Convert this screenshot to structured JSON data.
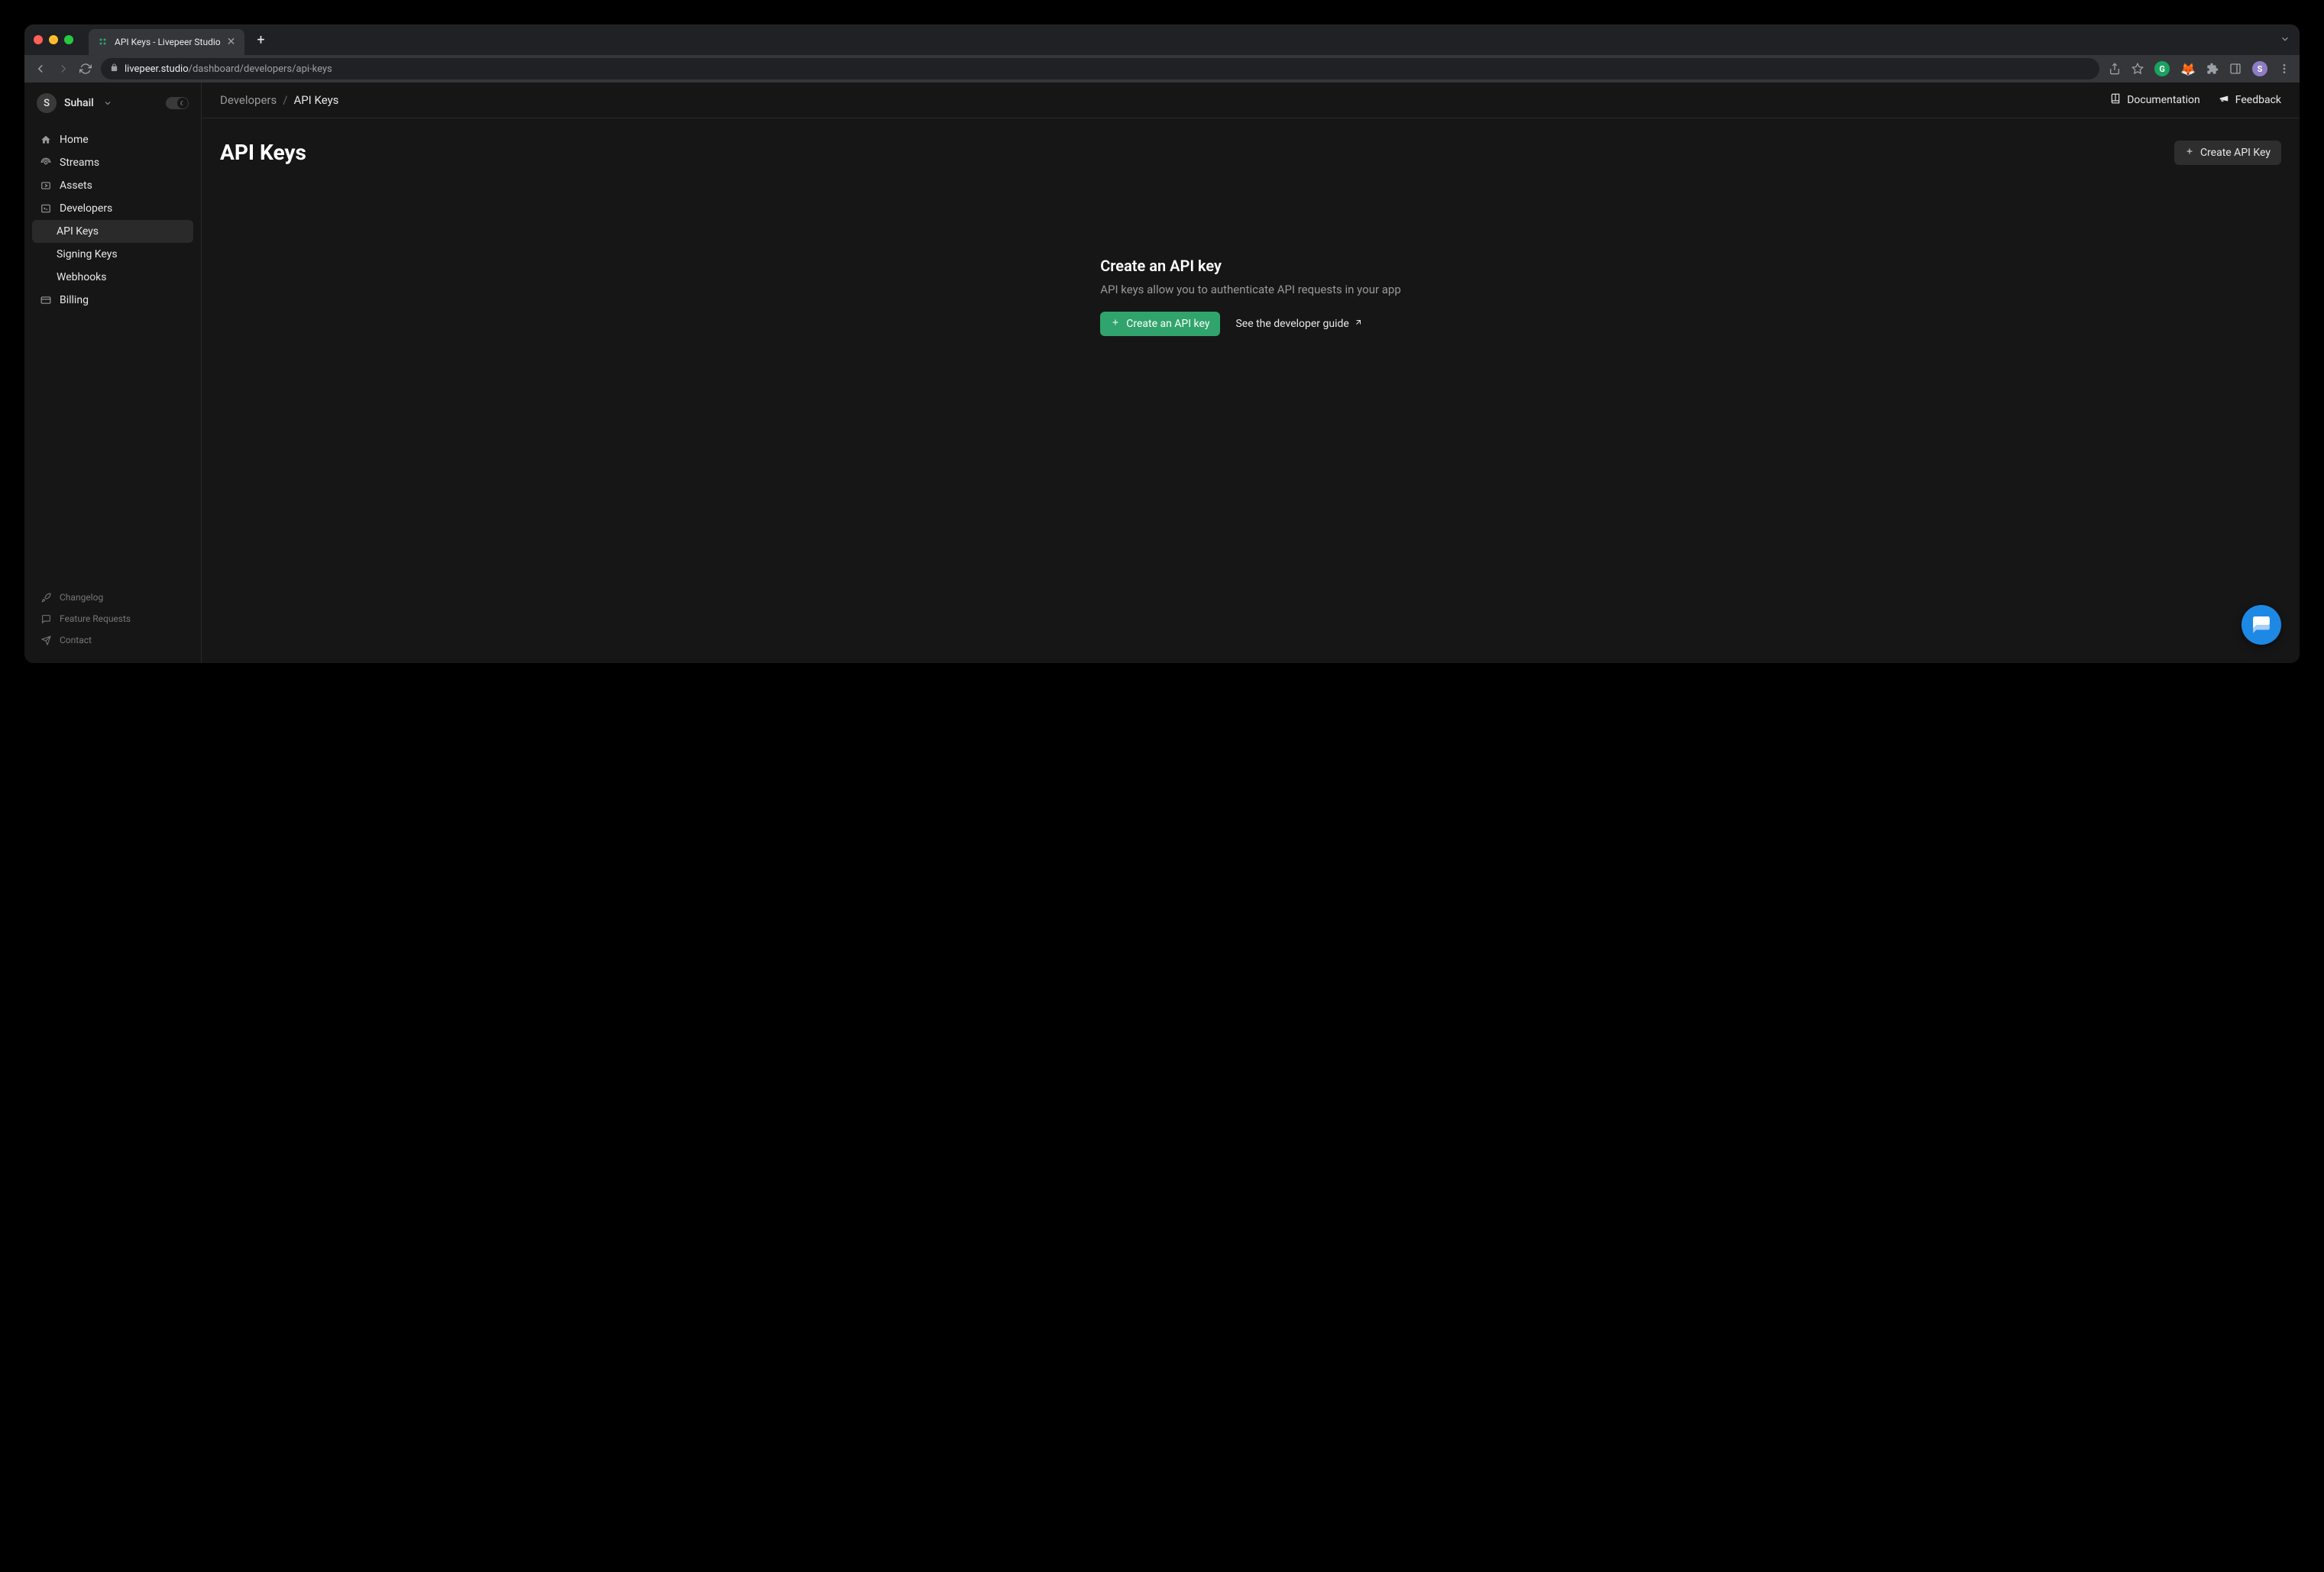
{
  "browser": {
    "tab_title": "API Keys - Livepeer Studio",
    "url_host": "livepeer.studio",
    "url_path": "/dashboard/developers/api-keys"
  },
  "sidebar": {
    "user_initial": "S",
    "user_name": "Suhail",
    "nav": [
      {
        "label": "Home"
      },
      {
        "label": "Streams"
      },
      {
        "label": "Assets"
      },
      {
        "label": "Developers"
      },
      {
        "label": "API Keys",
        "sub": true,
        "active": true
      },
      {
        "label": "Signing Keys",
        "sub": true
      },
      {
        "label": "Webhooks",
        "sub": true
      },
      {
        "label": "Billing"
      }
    ],
    "footer": [
      {
        "label": "Changelog"
      },
      {
        "label": "Feature Requests"
      },
      {
        "label": "Contact"
      }
    ]
  },
  "topbar": {
    "breadcrumb": [
      "Developers",
      "API Keys"
    ],
    "links": {
      "documentation": "Documentation",
      "feedback": "Feedback"
    }
  },
  "page": {
    "title": "API Keys",
    "create_button": "Create API Key"
  },
  "empty": {
    "title": "Create an API key",
    "description": "API keys allow you to authenticate API requests in your app",
    "primary_action": "Create an API key",
    "secondary_action": "See the developer guide"
  }
}
